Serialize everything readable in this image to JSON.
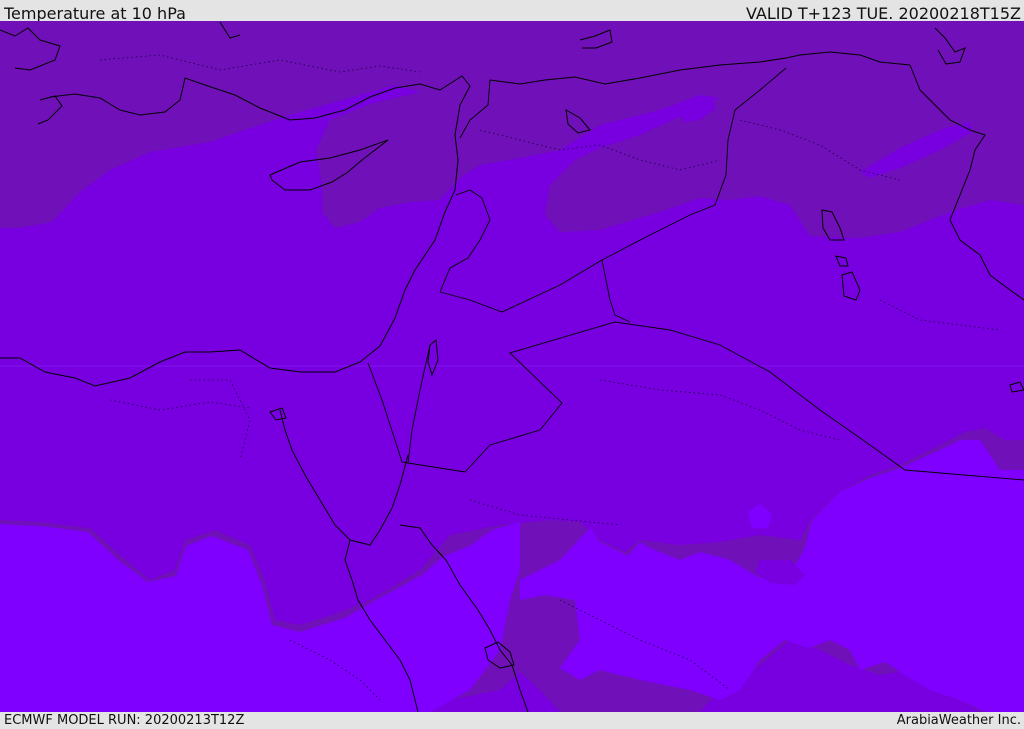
{
  "header": {
    "title": "Temperature at 10 hPa",
    "valid": "VALID T+123 TUE. 20200218T15Z"
  },
  "footer": {
    "model_run": "ECMWF MODEL RUN: 20200213T12Z",
    "credit": "ArabiaWeather Inc."
  },
  "colors": {
    "band_dark": "#7010b8",
    "band_mid": "#7800e0",
    "band_light": "#7f00ff",
    "coast": "#000000",
    "frame": "#e4e4e4"
  }
}
